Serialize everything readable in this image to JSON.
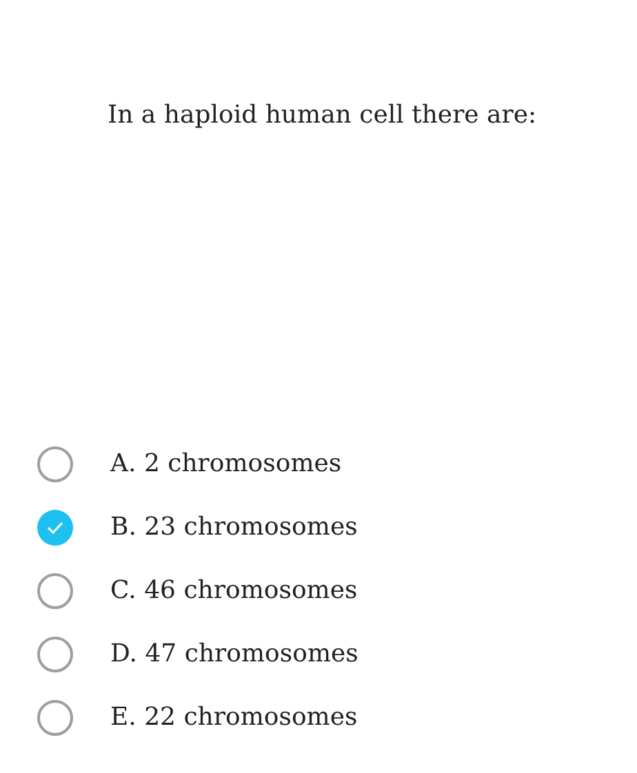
{
  "question": "In a haploid human cell there are:",
  "options": [
    {
      "label": "A. 2 chromosomes",
      "selected": false
    },
    {
      "label": "B. 23 chromosomes",
      "selected": true
    },
    {
      "label": "C. 46 chromosomes",
      "selected": false
    },
    {
      "label": "D. 47 chromosomes",
      "selected": false
    },
    {
      "label": "E. 22 chromosomes",
      "selected": false
    }
  ]
}
